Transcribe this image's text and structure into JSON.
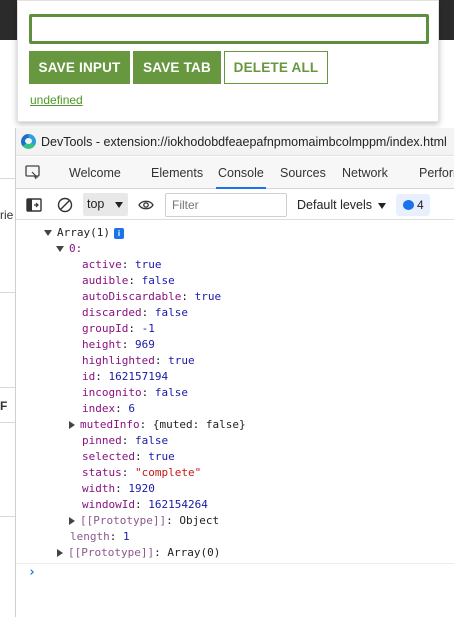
{
  "popup": {
    "input_value": "",
    "buttons": {
      "save_input": "SAVE INPUT",
      "save_tab": "SAVE TAB",
      "delete_all": "DELETE ALL"
    },
    "link_text": "undefined"
  },
  "background": {
    "fragments": [
      "rie",
      "F"
    ]
  },
  "devtools": {
    "title": "DevTools - extension://iokhodobdfeaepafnpmomaimbcolmppm/index.html",
    "tabs": [
      "Welcome",
      "Elements",
      "Console",
      "Sources",
      "Network",
      "Perform"
    ],
    "active_tab": "Console",
    "toolbar": {
      "context": "top",
      "filter_placeholder": "Filter",
      "levels": "Default levels",
      "message_count": "4"
    },
    "console": {
      "array_header": "Array(1)",
      "array_badge": "i",
      "index_label": "0:",
      "properties": [
        {
          "key": "active",
          "value": "true",
          "type": "bool"
        },
        {
          "key": "audible",
          "value": "false",
          "type": "bool"
        },
        {
          "key": "autoDiscardable",
          "value": "true",
          "type": "bool"
        },
        {
          "key": "discarded",
          "value": "false",
          "type": "bool"
        },
        {
          "key": "groupId",
          "value": "-1",
          "type": "num"
        },
        {
          "key": "height",
          "value": "969",
          "type": "num"
        },
        {
          "key": "highlighted",
          "value": "true",
          "type": "bool"
        },
        {
          "key": "id",
          "value": "162157194",
          "type": "num"
        },
        {
          "key": "incognito",
          "value": "false",
          "type": "bool"
        },
        {
          "key": "index",
          "value": "6",
          "type": "num"
        }
      ],
      "muted_info_key": "mutedInfo",
      "muted_info_value": "{muted: false}",
      "properties2": [
        {
          "key": "pinned",
          "value": "false",
          "type": "bool"
        },
        {
          "key": "selected",
          "value": "true",
          "type": "bool"
        },
        {
          "key": "status",
          "value": "\"complete\"",
          "type": "str"
        },
        {
          "key": "width",
          "value": "1920",
          "type": "num"
        },
        {
          "key": "windowId",
          "value": "162154264",
          "type": "num"
        }
      ],
      "prototype_object_key": "[[Prototype]]",
      "prototype_object_value": "Object",
      "length_key": "length",
      "length_value": "1",
      "prototype_array_key": "[[Prototype]]",
      "prototype_array_value": "Array(0)",
      "prompt": "›"
    }
  }
}
